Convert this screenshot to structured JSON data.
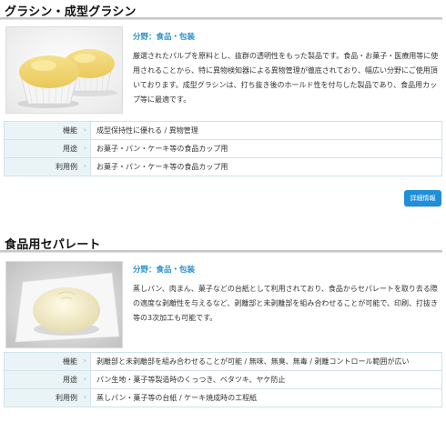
{
  "products": [
    {
      "heading": "グラシン・成型グラシン",
      "field": "分野：食品・包装",
      "description": "厳選されたパルプを原料とし、抜群の透明性をもった製品です。食品・お菓子・医療用等に使用されることから、特に異物検知器による異物管理が徹底されており、幅広い分野にご使用頂いております。成型グラシンは、打ち抜き後のホールド性を付与した製品であり、食品用カップ等に最適です。",
      "photo": "cupcake-photo",
      "specs": [
        {
          "label": "機能",
          "value": "成型保持性に優れる / 異物管理"
        },
        {
          "label": "用途",
          "value": "お菓子・パン・ケーキ等の食品カップ用"
        },
        {
          "label": "利用例",
          "value": "お菓子・パン・ケーキ等の食品カップ用"
        }
      ],
      "button": "詳細情報"
    },
    {
      "heading": "食品用セパレート",
      "field": "分野：食品・包装",
      "description": "蒸しパン、肉まん、菓子などの台紙として利用されており、食品からセパレートを取り去る際の適度な剥離性を与えるなど、剥離部と未剥離部を組み合わせることが可能で、印刷、打抜き等の3次加工も可能です。",
      "photo": "steamed-bun-photo",
      "specs": [
        {
          "label": "機能",
          "value": "剥離部と未剥離部を組み合わせることが可能 / 無味、無臭、無毒 / 剥離コントロール範囲が広い"
        },
        {
          "label": "用途",
          "value": "パン生地・菓子等製造時のくっつき、ベタツキ、ヤケ防止"
        },
        {
          "label": "利用例",
          "value": "蒸しパン・菓子等の台紙 / ケーキ焼成時の工程紙"
        }
      ]
    }
  ],
  "icons": {
    "row_arrow": "chevron-right-icon"
  },
  "colors": {
    "accent": "#1f8fd8",
    "field_text": "#2a8fcf",
    "label_bg": "#eaf4f7"
  }
}
